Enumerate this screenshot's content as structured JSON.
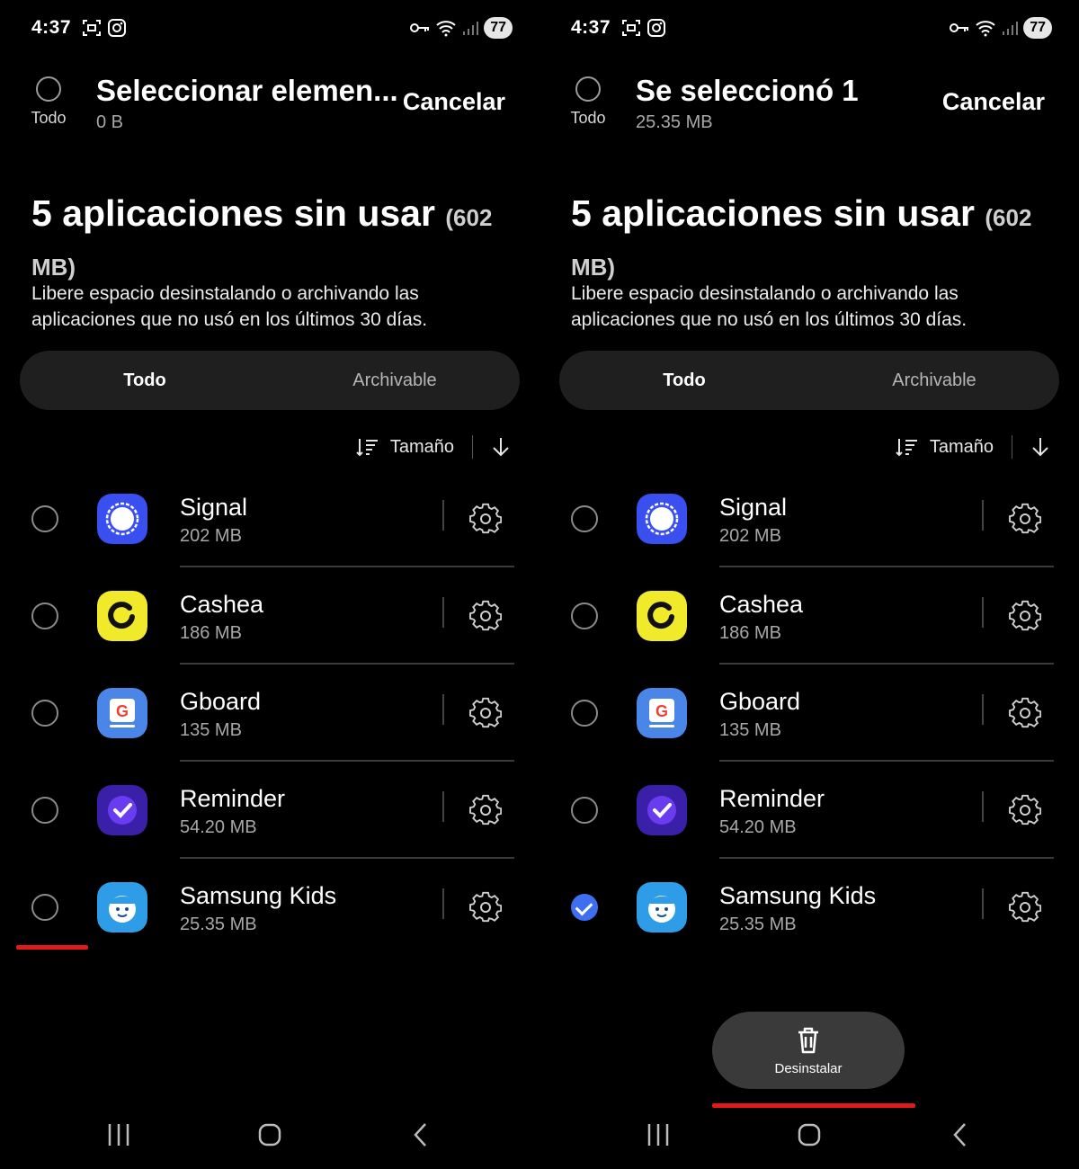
{
  "left_screen": {
    "status": {
      "time": "4:37",
      "battery": "77"
    },
    "header": {
      "select_all_label": "Todo",
      "title": "Seleccionar elemen...",
      "subtitle": "0 B",
      "cancel_label": "Cancelar"
    },
    "heading": {
      "main": "5 aplicaciones sin usar",
      "size": "(602 MB)"
    },
    "description": "Libere espacio desinstalando o archivando las aplicaciones que no usó en los últimos 30 días.",
    "tabs": [
      {
        "label": "Todo",
        "active": true
      },
      {
        "label": "Archivable",
        "active": false
      }
    ],
    "sort": {
      "label": "Tamaño",
      "icon": "sort-lines-icon",
      "direction_icon": "arrow-down-icon"
    },
    "apps": [
      {
        "name": "Signal",
        "size": "202 MB",
        "checked": false,
        "icon": "signal-icon"
      },
      {
        "name": "Cashea",
        "size": "186 MB",
        "checked": false,
        "icon": "cashea-icon"
      },
      {
        "name": "Gboard",
        "size": "135 MB",
        "checked": false,
        "icon": "gboard-icon"
      },
      {
        "name": "Reminder",
        "size": "54.20 MB",
        "checked": false,
        "icon": "reminder-icon"
      },
      {
        "name": "Samsung Kids",
        "size": "25.35 MB",
        "checked": false,
        "icon": "samsung-kids-icon"
      }
    ]
  },
  "right_screen": {
    "status": {
      "time": "4:37",
      "battery": "77"
    },
    "header": {
      "select_all_label": "Todo",
      "title": "Se seleccionó 1",
      "subtitle": "25.35 MB",
      "cancel_label": "Cancelar"
    },
    "heading": {
      "main": "5 aplicaciones sin usar",
      "size": "(602 MB)"
    },
    "description": "Libere espacio desinstalando o archivando las aplicaciones que no usó en los últimos 30 días.",
    "tabs": [
      {
        "label": "Todo",
        "active": true
      },
      {
        "label": "Archivable",
        "active": false
      }
    ],
    "sort": {
      "label": "Tamaño",
      "icon": "sort-lines-icon",
      "direction_icon": "arrow-down-icon"
    },
    "apps": [
      {
        "name": "Signal",
        "size": "202 MB",
        "checked": false,
        "icon": "signal-icon"
      },
      {
        "name": "Cashea",
        "size": "186 MB",
        "checked": false,
        "icon": "cashea-icon"
      },
      {
        "name": "Gboard",
        "size": "135 MB",
        "checked": false,
        "icon": "gboard-icon"
      },
      {
        "name": "Reminder",
        "size": "54.20 MB",
        "checked": false,
        "icon": "reminder-icon"
      },
      {
        "name": "Samsung Kids",
        "size": "25.35 MB",
        "checked": true,
        "icon": "samsung-kids-icon"
      }
    ],
    "action": {
      "label": "Desinstalar",
      "icon": "trash-icon"
    }
  },
  "colors": {
    "accent": "#3e6ff0",
    "highlight": "#e01919",
    "background": "#000000"
  }
}
